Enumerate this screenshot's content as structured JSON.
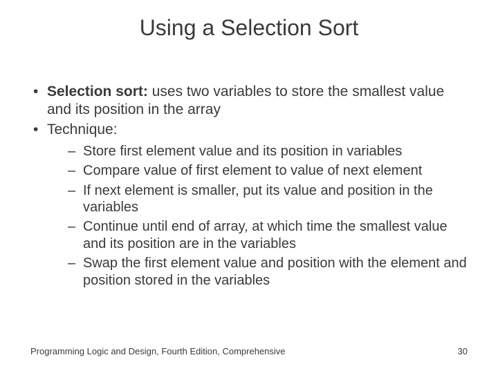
{
  "title": "Using a Selection Sort",
  "bullets": [
    {
      "bold": "Selection sort:",
      "rest": " uses two variables to store the smallest value and its position in the array"
    },
    {
      "bold": "",
      "rest": "Technique:",
      "sub": [
        "Store first element value and its position in variables",
        "Compare value of first element to value of next element",
        "If next element is smaller, put its value and position in the variables",
        "Continue until end of array, at which time the smallest value and its position are in the variables",
        "Swap the first element value and position with the element and position stored in the variables"
      ]
    }
  ],
  "footer": {
    "left": "Programming Logic and Design, Fourth Edition, Comprehensive",
    "page": "30"
  }
}
